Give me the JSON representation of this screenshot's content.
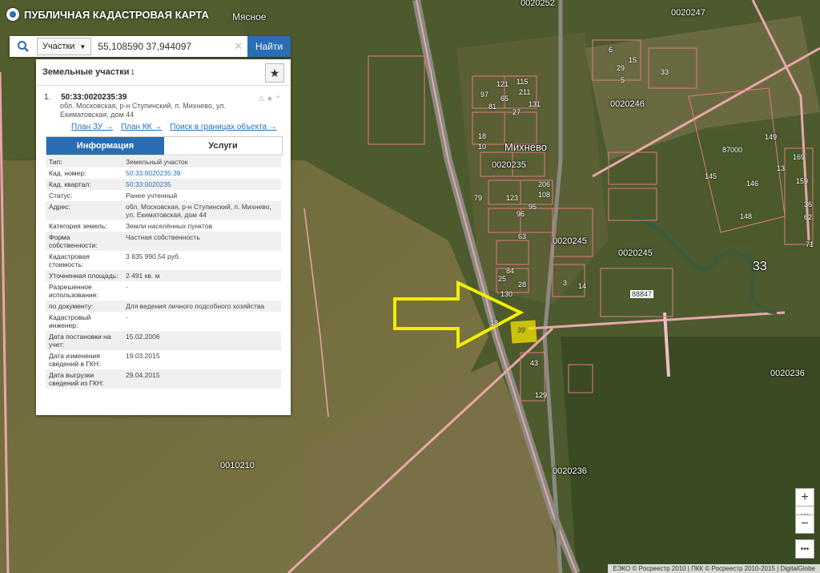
{
  "app": {
    "title": "ПУБЛИЧНАЯ КАДАСТРОВАЯ КАРТА"
  },
  "search": {
    "type_selected": "Участки",
    "value": "55,108590 37,944097",
    "find_label": "Найти"
  },
  "panel": {
    "header": "Земельные участки",
    "count": "1",
    "result": {
      "index": "1.",
      "cad_number": "50:33:0020235:39",
      "address_line1": "обл. Московская, р-н Ступинский, п. Михнево, ул.",
      "address_line2": "Екиматовская, дом 44",
      "links": [
        "План ЗУ →",
        "План КК →",
        "Поиск в границах объекта →"
      ]
    },
    "tabs": [
      "Информация",
      "Услуги"
    ],
    "rows": [
      {
        "k": "Тип:",
        "v": "Земельный участок"
      },
      {
        "k": "Кад. номер:",
        "v": "50:33:0020235:39"
      },
      {
        "k": "Кад. квартал:",
        "v": "50:33:0020235"
      },
      {
        "k": "Статус:",
        "v": "Ранее учтенный"
      },
      {
        "k": "Адрес:",
        "v": "обл. Московская, р-н Ступинский, п. Михнево, ул. Екиматовская, дом 44"
      },
      {
        "k": "Категория земель:",
        "v": "Земли населённых пунктов"
      },
      {
        "k": "Форма собственности:",
        "v": "Частная собственность"
      },
      {
        "k": "Кадастровая стоимость:",
        "v": "3 835 990,54 руб."
      },
      {
        "k": "Уточненная площадь:",
        "v": "2 491 кв. м"
      },
      {
        "k": "Разрешенное использование:",
        "v": "-"
      },
      {
        "k": "по документу:",
        "v": "Для ведения личного подсобного хозяйства"
      },
      {
        "k": "Кадастровый инженер:",
        "v": "-"
      },
      {
        "k": "Дата постановки на учет:",
        "v": "15.02.2006"
      },
      {
        "k": "Дата изменения сведений в ГКН:",
        "v": "19.03.2015"
      },
      {
        "k": "Дата выгрузки сведений из ГКН:",
        "v": "29.04.2015"
      }
    ]
  },
  "map": {
    "place_labels": [
      "Мясное",
      "Михнево"
    ],
    "quarter_labels": [
      "0020247",
      "0020246",
      "0020235",
      "0020245",
      "0020245",
      "0020236",
      "0010210",
      "0020236",
      "0020252"
    ],
    "parcel_numbers": [
      "121",
      "115",
      "97",
      "65",
      "211",
      "131",
      "81",
      "27",
      "18",
      "10",
      "79",
      "206",
      "108",
      "95",
      "123",
      "96",
      "63",
      "84",
      "25",
      "28",
      "130",
      "39",
      "43",
      "129",
      "14",
      "3",
      "87000",
      "146",
      "145",
      "148",
      "149",
      "169",
      "159",
      "36",
      "62",
      "71",
      "13",
      "88847",
      "6",
      "15",
      "29",
      "5",
      "33",
      "18"
    ],
    "big_number": "33"
  },
  "attribution": "ЕЭКО © Росреестр 2010 | ПКК © Росреестр 2010-2015 | DigitalGlobe",
  "icons": [
    "logo-icon",
    "search-icon",
    "chevron-down-icon",
    "close-icon",
    "star-icon",
    "zoom-in-icon",
    "zoom-out-icon",
    "more-icon"
  ]
}
